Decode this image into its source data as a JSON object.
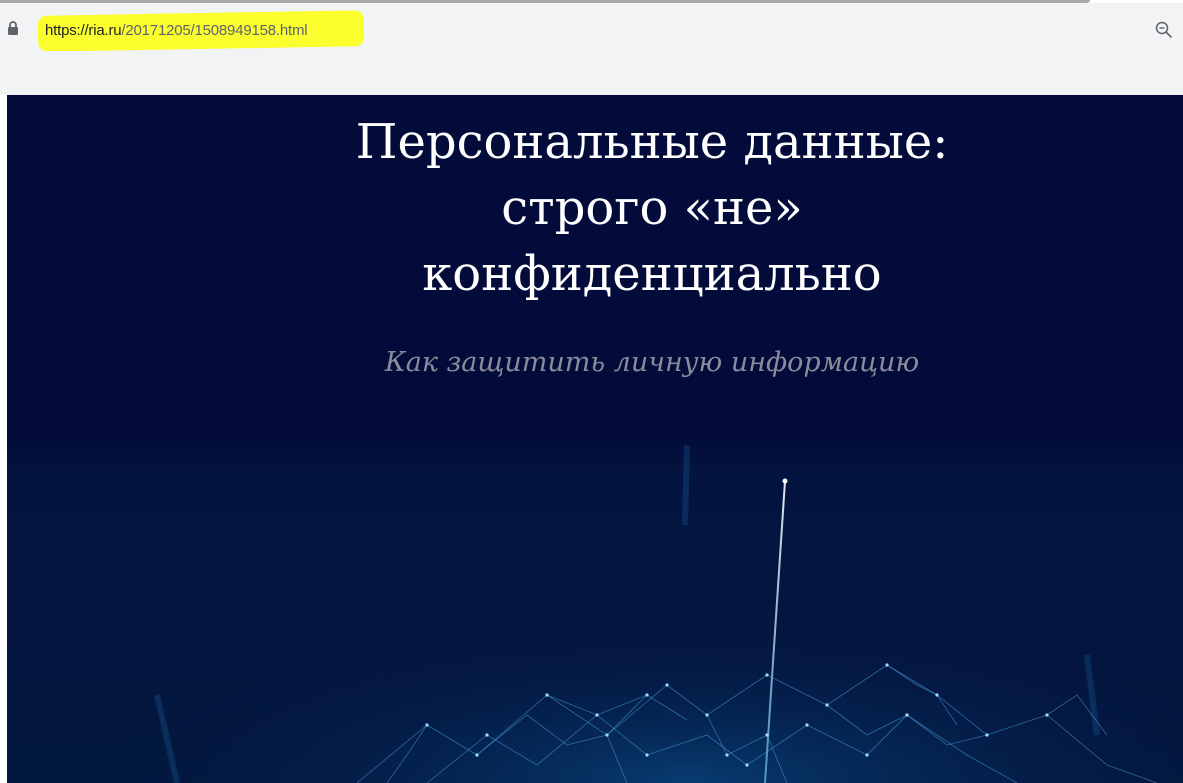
{
  "browser": {
    "url_scheme_host": "https://ria.ru",
    "url_path": "/20171205/1508949158.html",
    "lock_icon": "lock-icon",
    "zoom_icon": "zoom-icon",
    "highlight_color": "#fbff2e"
  },
  "article": {
    "title_lines": [
      "Персональные данные:",
      "строго «не»",
      "конфиденциально"
    ],
    "subtitle": "Как защитить личную информацию",
    "background_color": "#020b3a"
  }
}
